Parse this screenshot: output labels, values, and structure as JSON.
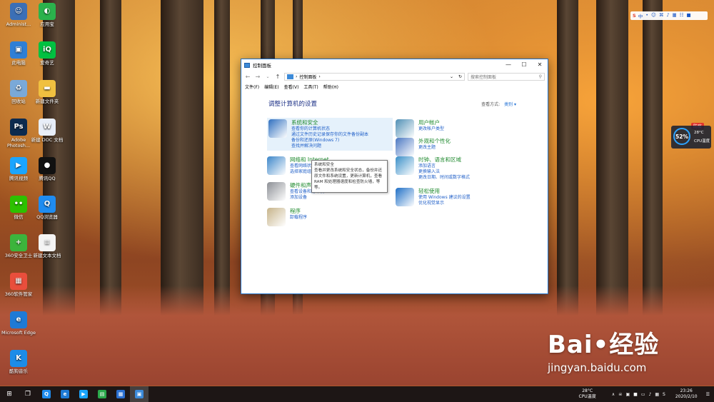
{
  "desktop": {
    "icons": [
      {
        "label": "Administ...",
        "color": "#3b6fb6",
        "glyph": "☺"
      },
      {
        "label": "应用宝",
        "color": "#2bb24c",
        "glyph": "◐"
      },
      {
        "label": "此电脑",
        "color": "#2f7fd6",
        "glyph": "▣"
      },
      {
        "label": "爱奇艺",
        "color": "#00c141",
        "glyph": "iQ"
      },
      {
        "label": "回收站",
        "color": "#7aa9d8",
        "glyph": "♻"
      },
      {
        "label": "新建文件夹",
        "color": "#f0c040",
        "glyph": "▬"
      },
      {
        "label": "Adobe Photosh...",
        "color": "#0c2a4e",
        "glyph": "Ps"
      },
      {
        "label": "新建 DOC 文档",
        "color": "#e8eef8",
        "glyph": "W"
      },
      {
        "label": "腾讯视频",
        "color": "#1aa5ff",
        "glyph": "▶"
      },
      {
        "label": "腾讯QQ",
        "color": "#111111",
        "glyph": "●"
      },
      {
        "label": "微信",
        "color": "#2dc100",
        "glyph": "••"
      },
      {
        "label": "QQ浏览器",
        "color": "#1f8cf0",
        "glyph": "Q"
      },
      {
        "label": "360安全卫士",
        "color": "#3cb43c",
        "glyph": "+"
      },
      {
        "label": "新建文本文档",
        "color": "#f4f4f4",
        "glyph": "≡"
      },
      {
        "label": "360软件管家",
        "color": "#e94e3c",
        "glyph": "▦"
      },
      {
        "label": "Microsoft Edge",
        "color": "#1e7ad6",
        "glyph": "e"
      },
      {
        "label": "酷狗音乐",
        "color": "#1c8ce8",
        "glyph": "K"
      }
    ]
  },
  "ime": {
    "logo": "S",
    "items": [
      "中",
      "•",
      "☺",
      "⌘",
      "♪",
      "▦",
      "☷",
      "■"
    ]
  },
  "weather_widget": {
    "tag": "防疫",
    "percent": "52%",
    "temp": "28°C",
    "label": "CPU温度"
  },
  "window": {
    "title": "控制面板",
    "minimize": "—",
    "maximize": "☐",
    "close": "✕",
    "address": "控制面板",
    "search_placeholder": "搜索控制面板",
    "menu": [
      "文件(F)",
      "编辑(E)",
      "查看(V)",
      "工具(T)",
      "帮助(H)"
    ],
    "heading": "调整计算机的设置",
    "view_by_label": "查看方式:",
    "view_by_value": "类别 ▾",
    "categories_left": [
      {
        "title": "系统和安全",
        "color": "#2f6fbf",
        "links": [
          "查看你的计算机状态",
          "通过文件历史记录保存你的文件备份副本",
          "备份和还原(Windows 7)",
          "查找并解决问题"
        ]
      },
      {
        "title": "网络和 Internet",
        "color": "#3c86c9",
        "links": [
          "查看网络状态和任务",
          "选择家庭组和共享选项"
        ]
      },
      {
        "title": "硬件和声音",
        "color": "#8c8f95",
        "links": [
          "查看设备和打印机",
          "添加设备"
        ]
      },
      {
        "title": "程序",
        "color": "#c7b48a",
        "links": [
          "卸载程序"
        ]
      }
    ],
    "categories_right": [
      {
        "title": "用户帐户",
        "color": "#4f8fb5",
        "links": [
          "更改帐户类型"
        ]
      },
      {
        "title": "外观和个性化",
        "color": "#4a77c2",
        "links": [
          "更改主题"
        ]
      },
      {
        "title": "时钟、语言和区域",
        "color": "#3a8fc8",
        "links": [
          "添加语言",
          "更换输入法",
          "更改日期、时间或数字格式"
        ]
      },
      {
        "title": "轻松使用",
        "color": "#1f6fc6",
        "links": [
          "使用 Windows 建议的设置",
          "优化视觉显示"
        ]
      }
    ],
    "tooltip": {
      "title": "系统和安全",
      "body": "查看并更改系统和安全状态，备份并还原文件和系统设置，更新计算机，查看 RAM 和处理器速度和检查防火墙，等等。"
    }
  },
  "taskbar": {
    "start": "⊞",
    "task_view": "❐",
    "apps": [
      {
        "glyph": "Q",
        "color": "#1f8cf0"
      },
      {
        "glyph": "e",
        "color": "#1e7ad6"
      },
      {
        "glyph": "▶",
        "color": "#1aa5ff"
      },
      {
        "glyph": "▤",
        "color": "#2aa84a"
      },
      {
        "glyph": "▦",
        "color": "#2a6fd0"
      },
      {
        "glyph": "▣",
        "color": "#3c8ad8"
      }
    ],
    "temp": "28°C",
    "temp_label": "CPU温度",
    "tray_icons": [
      "∧",
      "☠",
      "▣",
      "■",
      "▭",
      "♪",
      "▦",
      "S"
    ],
    "time": "23:26",
    "date": "2020/2/10"
  },
  "watermark": {
    "brand": "Bai•经验",
    "url": "jingyan.baidu.com"
  }
}
